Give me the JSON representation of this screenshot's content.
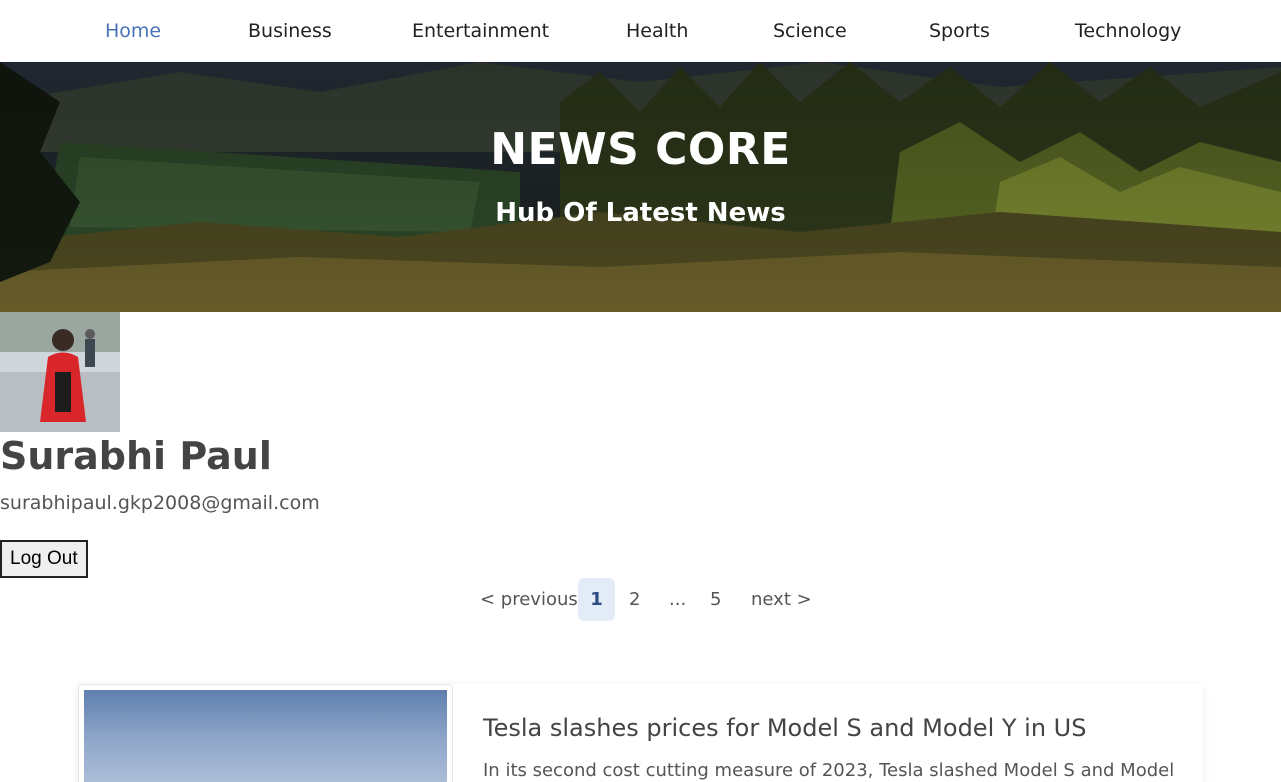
{
  "nav": {
    "items": [
      {
        "label": "Home",
        "active": true
      },
      {
        "label": "Business",
        "active": false
      },
      {
        "label": "Entertainment",
        "active": false
      },
      {
        "label": "Health",
        "active": false
      },
      {
        "label": "Science",
        "active": false
      },
      {
        "label": "Sports",
        "active": false
      },
      {
        "label": "Technology",
        "active": false
      }
    ]
  },
  "hero": {
    "title": "NEWS CORE",
    "subtitle": "Hub Of Latest News"
  },
  "profile": {
    "name": "Surabhi Paul",
    "email": "surabhipaul.gkp2008@gmail.com",
    "logout_label": "Log Out"
  },
  "pagination": {
    "previous_label": "< previous",
    "pages": [
      "1",
      "2",
      "...",
      "5"
    ],
    "current": "1",
    "next_label": "next >"
  },
  "articles": [
    {
      "title": "Tesla slashes prices for Model S and Model Y in US",
      "description": "In its second cost cutting measure of 2023, Tesla slashed Model S and Model"
    }
  ],
  "colors": {
    "active_nav": "#4a73b7",
    "current_page_bg": "#e3ebf7"
  }
}
